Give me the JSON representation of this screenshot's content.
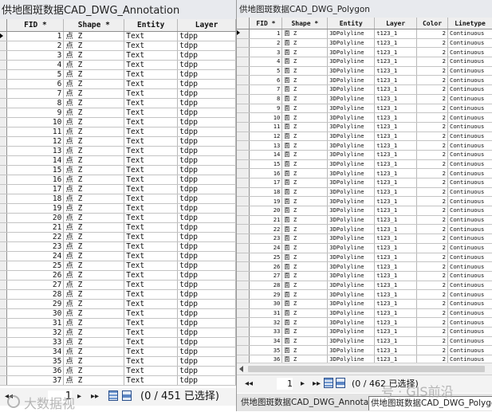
{
  "left_panel": {
    "title": "供地图斑数据CAD_DWG_Annotation",
    "columns": [
      "FID *",
      "Shape *",
      "Entity",
      "Layer"
    ],
    "rows": [
      [
        "1",
        "点 Z",
        "Text",
        "tdpp"
      ],
      [
        "2",
        "点 Z",
        "Text",
        "tdpp"
      ],
      [
        "3",
        "点 Z",
        "Text",
        "tdpp"
      ],
      [
        "4",
        "点 Z",
        "Text",
        "tdpp"
      ],
      [
        "5",
        "点 Z",
        "Text",
        "tdpp"
      ],
      [
        "6",
        "点 Z",
        "Text",
        "tdpp"
      ],
      [
        "7",
        "点 Z",
        "Text",
        "tdpp"
      ],
      [
        "8",
        "点 Z",
        "Text",
        "tdpp"
      ],
      [
        "9",
        "点 Z",
        "Text",
        "tdpp"
      ],
      [
        "10",
        "点 Z",
        "Text",
        "tdpp"
      ],
      [
        "11",
        "点 Z",
        "Text",
        "tdpp"
      ],
      [
        "12",
        "点 Z",
        "Text",
        "tdpp"
      ],
      [
        "13",
        "点 Z",
        "Text",
        "tdpp"
      ],
      [
        "14",
        "点 Z",
        "Text",
        "tdpp"
      ],
      [
        "15",
        "点 Z",
        "Text",
        "tdpp"
      ],
      [
        "16",
        "点 Z",
        "Text",
        "tdpp"
      ],
      [
        "17",
        "点 Z",
        "Text",
        "tdpp"
      ],
      [
        "18",
        "点 Z",
        "Text",
        "tdpp"
      ],
      [
        "19",
        "点 Z",
        "Text",
        "tdpp"
      ],
      [
        "20",
        "点 Z",
        "Text",
        "tdpp"
      ],
      [
        "21",
        "点 Z",
        "Text",
        "tdpp"
      ],
      [
        "22",
        "点 Z",
        "Text",
        "tdpp"
      ],
      [
        "23",
        "点 Z",
        "Text",
        "tdpp"
      ],
      [
        "24",
        "点 Z",
        "Text",
        "tdpp"
      ],
      [
        "25",
        "点 Z",
        "Text",
        "tdpp"
      ],
      [
        "26",
        "点 Z",
        "Text",
        "tdpp"
      ],
      [
        "27",
        "点 Z",
        "Text",
        "tdpp"
      ],
      [
        "28",
        "点 Z",
        "Text",
        "tdpp"
      ],
      [
        "29",
        "点 Z",
        "Text",
        "tdpp"
      ],
      [
        "30",
        "点 Z",
        "Text",
        "tdpp"
      ],
      [
        "31",
        "点 Z",
        "Text",
        "tdpp"
      ],
      [
        "32",
        "点 Z",
        "Text",
        "tdpp"
      ],
      [
        "33",
        "点 Z",
        "Text",
        "tdpp"
      ],
      [
        "34",
        "点 Z",
        "Text",
        "tdpp"
      ],
      [
        "35",
        "点 Z",
        "Text",
        "tdpp"
      ],
      [
        "36",
        "点 Z",
        "Text",
        "tdpp"
      ],
      [
        "37",
        "点 Z",
        "Text",
        "tdpp"
      ]
    ],
    "nav": {
      "first": "◂◂",
      "record": "1",
      "next": "▸",
      "last": "▸▸",
      "status": "(0 / 451 已选择)"
    }
  },
  "right_panel": {
    "title": "供地图斑数据CAD_DWG_Polygon",
    "columns": [
      "FID *",
      "Shape *",
      "Entity",
      "Layer",
      "Color",
      "Linetype"
    ],
    "rows": [
      [
        "1",
        "面 Z",
        "3DPolyline",
        "t123_1",
        "2",
        "Continuous"
      ],
      [
        "2",
        "面 Z",
        "3DPolyline",
        "t123_1",
        "2",
        "Continuous"
      ],
      [
        "3",
        "面 Z",
        "3DPolyline",
        "t123_1",
        "2",
        "Continuous"
      ],
      [
        "4",
        "面 Z",
        "3DPolyline",
        "t123_1",
        "2",
        "Continuous"
      ],
      [
        "5",
        "面 Z",
        "3DPolyline",
        "t123_1",
        "2",
        "Continuous"
      ],
      [
        "6",
        "面 Z",
        "3DPolyline",
        "t123_1",
        "2",
        "Continuous"
      ],
      [
        "7",
        "面 Z",
        "3DPolyline",
        "t123_1",
        "2",
        "Continuous"
      ],
      [
        "8",
        "面 Z",
        "3DPolyline",
        "t123_1",
        "2",
        "Continuous"
      ],
      [
        "9",
        "面 Z",
        "3DPolyline",
        "t123_1",
        "2",
        "Continuous"
      ],
      [
        "10",
        "面 Z",
        "3DPolyline",
        "t123_1",
        "2",
        "Continuous"
      ],
      [
        "11",
        "面 Z",
        "3DPolyline",
        "t123_1",
        "2",
        "Continuous"
      ],
      [
        "12",
        "面 Z",
        "3DPolyline",
        "t123_1",
        "2",
        "Continuous"
      ],
      [
        "13",
        "面 Z",
        "3DPolyline",
        "t123_1",
        "2",
        "Continuous"
      ],
      [
        "14",
        "面 Z",
        "3DPolyline",
        "t123_1",
        "2",
        "Continuous"
      ],
      [
        "15",
        "面 Z",
        "3DPolyline",
        "t123_1",
        "2",
        "Continuous"
      ],
      [
        "16",
        "面 Z",
        "3DPolyline",
        "t123_1",
        "2",
        "Continuous"
      ],
      [
        "17",
        "面 Z",
        "3DPolyline",
        "t123_1",
        "2",
        "Continuous"
      ],
      [
        "18",
        "面 Z",
        "3DPolyline",
        "t123_1",
        "2",
        "Continuous"
      ],
      [
        "19",
        "面 Z",
        "3DPolyline",
        "t123_1",
        "2",
        "Continuous"
      ],
      [
        "20",
        "面 Z",
        "3DPolyline",
        "t123_1",
        "2",
        "Continuous"
      ],
      [
        "21",
        "面 Z",
        "3DPolyline",
        "t123_1",
        "2",
        "Continuous"
      ],
      [
        "22",
        "面 Z",
        "3DPolyline",
        "t123_1",
        "2",
        "Continuous"
      ],
      [
        "23",
        "面 Z",
        "3DPolyline",
        "t123_1",
        "2",
        "Continuous"
      ],
      [
        "24",
        "面 Z",
        "3DPolyline",
        "t123_1",
        "2",
        "Continuous"
      ],
      [
        "25",
        "面 Z",
        "3DPolyline",
        "t123_1",
        "2",
        "Continuous"
      ],
      [
        "26",
        "面 Z",
        "3DPolyline",
        "t123_1",
        "2",
        "Continuous"
      ],
      [
        "27",
        "面 Z",
        "3DPolyline",
        "t123_1",
        "2",
        "Continuous"
      ],
      [
        "28",
        "面 Z",
        "3DPolyline",
        "t123_1",
        "2",
        "Continuous"
      ],
      [
        "29",
        "面 Z",
        "3DPolyline",
        "t123_1",
        "2",
        "Continuous"
      ],
      [
        "30",
        "面 Z",
        "3DPolyline",
        "t123_1",
        "2",
        "Continuous"
      ],
      [
        "31",
        "面 Z",
        "3DPolyline",
        "t123_1",
        "2",
        "Continuous"
      ],
      [
        "32",
        "面 Z",
        "3DPolyline",
        "t123_1",
        "2",
        "Continuous"
      ],
      [
        "33",
        "面 Z",
        "3DPolyline",
        "t123_1",
        "2",
        "Continuous"
      ],
      [
        "34",
        "面 Z",
        "3DPolyline",
        "t123_1",
        "2",
        "Continuous"
      ],
      [
        "35",
        "面 Z",
        "3DPolyline",
        "t123_1",
        "2",
        "Continuous"
      ],
      [
        "36",
        "面 Z",
        "3DPolyline",
        "t123_1",
        "2",
        "Continuous"
      ]
    ],
    "nav": {
      "first": "◂◂",
      "record": "1",
      "next": "▸",
      "last": "▸▸",
      "status": "(0 / 462 已选择)"
    },
    "tabs": [
      {
        "label": "供地图斑数据CAD_DWG_Annotation",
        "active": false
      },
      {
        "label": "供地图斑数据CAD_DWG_Polygon",
        "active": true
      }
    ]
  },
  "watermark": {
    "left_text": "大数据视",
    "right_text": "号 · GIS前沿"
  }
}
